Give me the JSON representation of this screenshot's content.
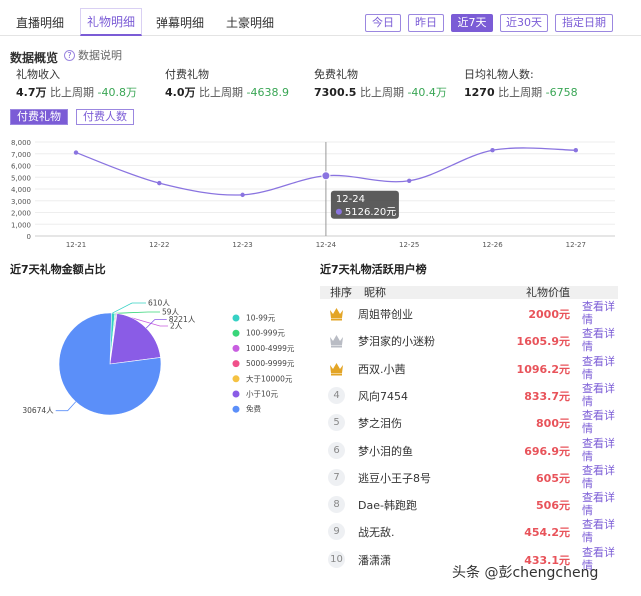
{
  "tabs": [
    {
      "label": "直播明细"
    },
    {
      "label": "礼物明细"
    },
    {
      "label": "弹幕明细"
    },
    {
      "label": "土豪明细"
    }
  ],
  "date_buttons": [
    {
      "label": "今日"
    },
    {
      "label": "昨日"
    },
    {
      "label": "近7天"
    },
    {
      "label": "近30天"
    },
    {
      "label": "指定日期"
    }
  ],
  "overview": {
    "title": "数据概览",
    "help_label": "数据说明",
    "help_icon": "question-icon",
    "compare_label": "比上周期",
    "metrics": [
      {
        "label": "礼物收入",
        "value": "4.7万",
        "delta": "-40.8万"
      },
      {
        "label": "付费礼物",
        "value": "4.0万",
        "delta": "-4638.9"
      },
      {
        "label": "免费礼物",
        "value": "7300.5",
        "delta": "-40.4万"
      },
      {
        "label": "日均礼物人数:",
        "value": "1270",
        "delta": "-6758"
      }
    ]
  },
  "sub_tabs": [
    {
      "label": "付费礼物"
    },
    {
      "label": "付费人数"
    }
  ],
  "chart_data": [
    {
      "type": "line",
      "x": [
        "12-21",
        "12-22",
        "12-23",
        "12-24",
        "12-25",
        "12-26",
        "12-27"
      ],
      "series": [
        {
          "values": [
            7100,
            4500,
            3500,
            5126.2,
            4700,
            7300,
            7300
          ]
        }
      ],
      "ylim": [
        0,
        8000
      ],
      "yticks": [
        "0",
        "1,000",
        "2,000",
        "3,000",
        "4,000",
        "5,000",
        "6,000",
        "7,000",
        "8,000"
      ],
      "grid": true,
      "tooltip": {
        "date": "12-24",
        "value": "5126.20元"
      },
      "color": "#8a74e0"
    },
    {
      "type": "pie",
      "title": "近7天礼物金额占比",
      "categories": [
        "10-99元",
        "100-999元",
        "1000-4999元",
        "5000-9999元",
        "大于10000元",
        "小于10元",
        "免费"
      ],
      "values": [
        610,
        59,
        2,
        0,
        0,
        8221,
        30674
      ],
      "slice_labels": [
        "610人",
        "59人",
        "2人",
        "",
        "",
        "8221人",
        "30674人"
      ],
      "colors": [
        "#36d1c4",
        "#39d67a",
        "#c85ee0",
        "#f0508a",
        "#f5c242",
        "#8a5ce6",
        "#5b8ff9"
      ],
      "legend": "right"
    }
  ],
  "ranking": {
    "title": "近7天礼物活跃用户榜",
    "headers": {
      "rank": "排序",
      "name": "昵称",
      "value": "礼物价值"
    },
    "link_label": "查看详情",
    "rows": [
      {
        "rank": "1",
        "name": "周姐带创业",
        "value": "2000元",
        "medal": "gold-crown-icon"
      },
      {
        "rank": "2",
        "name": "梦泪家的小迷粉",
        "value": "1605.9元",
        "medal": "silver-crown-icon"
      },
      {
        "rank": "3",
        "name": "西双.小茜",
        "value": "1096.2元",
        "medal": "gold-crown-icon"
      },
      {
        "rank": "4",
        "name": "风向7454",
        "value": "833.7元"
      },
      {
        "rank": "5",
        "name": "梦之泪伤",
        "value": "800元"
      },
      {
        "rank": "6",
        "name": "梦小泪的鱼",
        "value": "696.9元"
      },
      {
        "rank": "7",
        "name": "逃豆小王子8号",
        "value": "605元"
      },
      {
        "rank": "8",
        "name": "Dae-韩跑跑",
        "value": "506元"
      },
      {
        "rank": "9",
        "name": "战无敌.",
        "value": "454.2元"
      },
      {
        "rank": "10",
        "name": "潘潇潇",
        "value": "433.1元"
      }
    ]
  },
  "watermark": "头条 @彭chengcheng",
  "colors": {
    "accent": "#7b5cd6",
    "positive": "#3aa655",
    "value_red": "#e8535a"
  }
}
